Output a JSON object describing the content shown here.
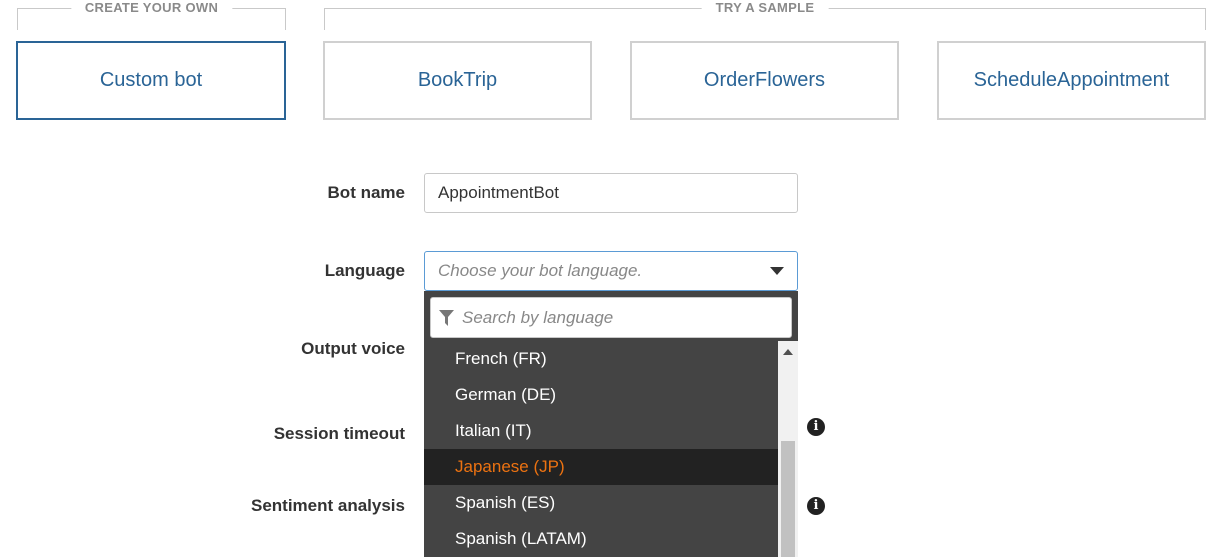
{
  "sections": {
    "create_label": "CREATE YOUR OWN",
    "sample_label": "TRY A SAMPLE"
  },
  "cards": {
    "custom": "Custom bot",
    "samples": [
      "BookTrip",
      "OrderFlowers",
      "ScheduleAppointment"
    ],
    "selected": "Custom bot"
  },
  "form": {
    "bot_name_label": "Bot name",
    "bot_name_value": "AppointmentBot",
    "language_label": "Language",
    "language_placeholder": "Choose your bot language.",
    "output_voice_label": "Output voice",
    "session_timeout_label": "Session timeout",
    "sentiment_label": "Sentiment analysis"
  },
  "dropdown": {
    "search_placeholder": "Search by language",
    "options": [
      "French (FR)",
      "German (DE)",
      "Italian (IT)",
      "Japanese (JP)",
      "Spanish (ES)",
      "Spanish (LATAM)"
    ],
    "highlighted": "Japanese (JP)"
  },
  "colors": {
    "accent": "#2a6496",
    "highlight_text": "#ec7211",
    "dropdown_bg": "#444444"
  },
  "icons": {
    "info": "info-icon",
    "filter": "filter-icon",
    "caret": "caret-down-icon"
  }
}
